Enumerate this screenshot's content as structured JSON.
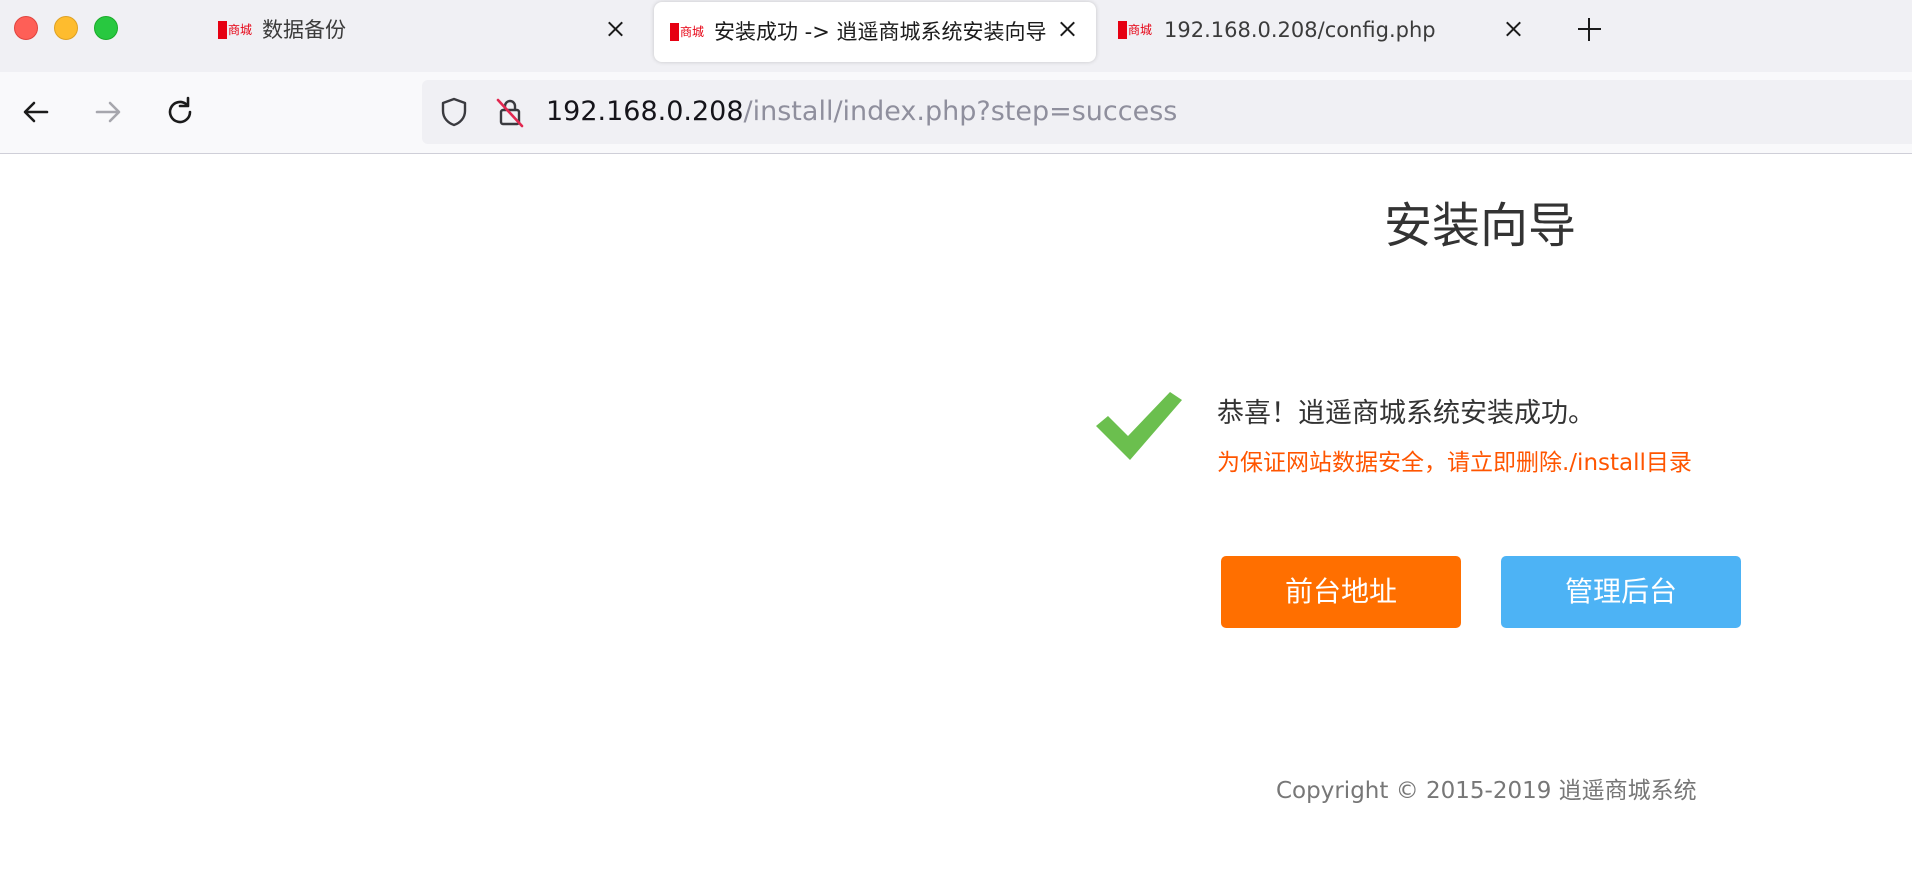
{
  "window": {
    "controls": [
      "close",
      "minimize",
      "zoom"
    ]
  },
  "tabs": [
    {
      "favicon_text": "商城",
      "title": "数据备份",
      "active": false
    },
    {
      "favicon_text": "商城",
      "title": "安装成功 -> 逍遥商城系统安装向导",
      "active": true
    },
    {
      "favicon_text": "商城",
      "title": "192.168.0.208/config.php",
      "active": false
    }
  ],
  "navbar": {
    "back_icon": "arrow-left-icon",
    "forward_icon": "arrow-right-icon",
    "reload_icon": "reload-icon",
    "url_host": "192.168.0.208",
    "url_path": "/install/index.php?step=success"
  },
  "page": {
    "title": "安装向导",
    "success_message": "恭喜！逍遥商城系统安装成功。",
    "warning_message": "为保证网站数据安全，请立即删除./install目录",
    "buttons": {
      "front_label": "前台地址",
      "admin_label": "管理后台"
    },
    "copyright": "Copyright © 2015-2019 逍遥商城系统"
  },
  "colors": {
    "brand_red": "#e60012",
    "warning": "#ff5500",
    "front_button": "#ff6f00",
    "admin_button": "#4db3f5",
    "checkmark": "#6bbf4e"
  }
}
